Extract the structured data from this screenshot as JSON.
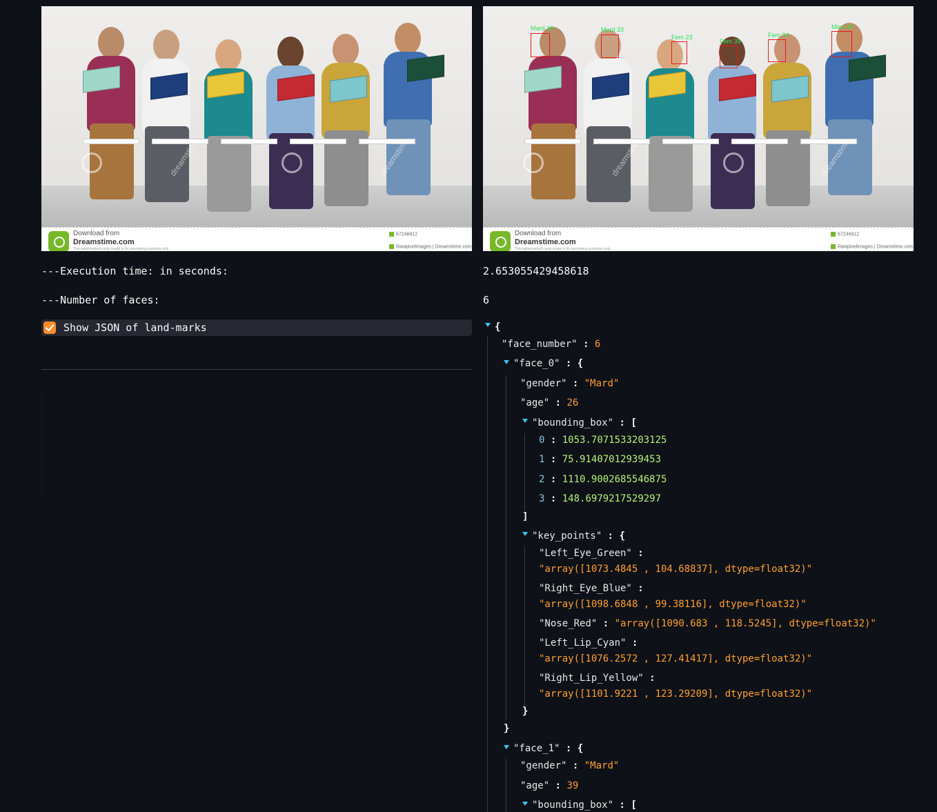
{
  "original_image": {
    "watermark_text": "dreamstime",
    "footer": {
      "download_from": "Download from",
      "brand": "Dreamstime.com",
      "fine_print": "This watermarked comp image is for previewing purposes only.",
      "id": "67246912",
      "credit": "Rawpixelimages | Dreamstime.com"
    }
  },
  "annotated_image": {
    "face_labels": [
      "Mard 39",
      "Mard 33",
      "Fem 23",
      "Fem 39",
      "Fem 24",
      "Mard 26"
    ],
    "box_color": "#e21b1b",
    "label_color": "#2fe05a"
  },
  "execution": {
    "label": "---Execution time: in seconds:",
    "value": "2.653055429458618"
  },
  "faces_count": {
    "label": "---Number of faces:",
    "value": "6"
  },
  "show_json_checkbox": {
    "label": "Show JSON of land-marks",
    "checked": true,
    "accent": "#ff8c2b"
  },
  "json_view": {
    "open_brace": "{",
    "face_number_key": "\"face_number\"",
    "face_number_val": "6",
    "face_0": {
      "key": "\"face_0\"",
      "gender_key": "\"gender\"",
      "gender_val": "\"Mard\"",
      "age_key": "\"age\"",
      "age_val": "26",
      "bbox_key": "\"bounding_box\"",
      "bbox": [
        {
          "i": "0",
          "v": "1053.7071533203125"
        },
        {
          "i": "1",
          "v": "75.91407012939453"
        },
        {
          "i": "2",
          "v": "1110.9002685546875"
        },
        {
          "i": "3",
          "v": "148.6979217529297"
        }
      ],
      "kp_key": "\"key_points\"",
      "left_eye_key": "\"Left_Eye_Green\"",
      "left_eye_val": "\"array([1073.4845 , 104.68837], dtype=float32)\"",
      "right_eye_key": "\"Right_Eye_Blue\"",
      "right_eye_val": "\"array([1098.6848 , 99.38116], dtype=float32)\"",
      "nose_key": "\"Nose_Red\"",
      "nose_val": "\"array([1090.683 , 118.5245], dtype=float32)\"",
      "left_lip_key": "\"Left_Lip_Cyan\"",
      "left_lip_val": "\"array([1076.2572 , 127.41417], dtype=float32)\"",
      "right_lip_key": "\"Right_Lip_Yellow\"",
      "right_lip_val": "\"array([1101.9221 , 123.29209], dtype=float32)\""
    },
    "face_1": {
      "key": "\"face_1\"",
      "gender_key": "\"gender\"",
      "gender_val": "\"Mard\"",
      "age_key": "\"age\"",
      "age_val": "39",
      "bbox_key": "\"bounding_box\""
    },
    "colon": ":",
    "obj_open": "{",
    "obj_close": "}",
    "arr_open": "[",
    "arr_close": "]"
  }
}
